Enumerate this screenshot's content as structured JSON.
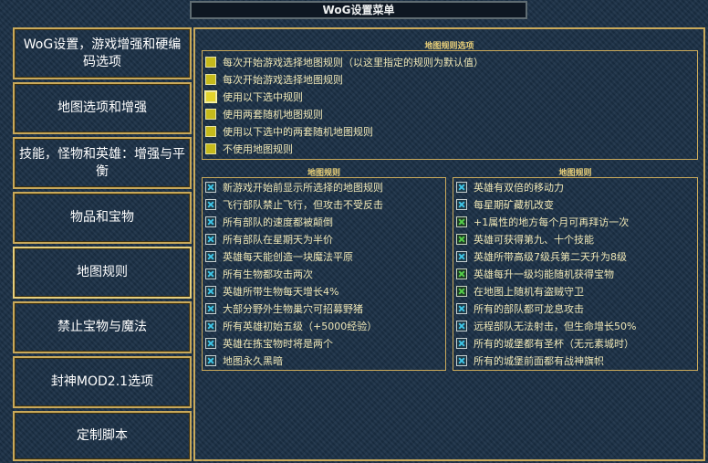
{
  "window": {
    "title": "WoG设置菜单"
  },
  "sidebar": {
    "items": [
      {
        "label": "WoG设置，游戏增强和硬编码选项"
      },
      {
        "label": "地图选项和增强"
      },
      {
        "label": "技能，怪物和英雄：增强与平衡"
      },
      {
        "label": "物品和宝物"
      },
      {
        "label": "地图规则",
        "active": true
      },
      {
        "label": "禁止宝物与魔法"
      },
      {
        "label": "封神MOD2.1选项"
      },
      {
        "label": "定制脚本"
      }
    ]
  },
  "map_rule_options": {
    "title": "地图规则选项",
    "options": [
      {
        "label": "每次开始游戏选择地图规则（以这里指定的规则为默认值）",
        "state": "yellow"
      },
      {
        "label": "每次开始游戏选择地图规则",
        "state": "yellow"
      },
      {
        "label": "使用以下选中规则",
        "state": "selected"
      },
      {
        "label": "使用两套随机地图规则",
        "state": "yellow"
      },
      {
        "label": "使用以下选中的两套随机地图规则",
        "state": "yellow"
      },
      {
        "label": "不使用地图规则",
        "state": "yellow"
      }
    ]
  },
  "rules_left": {
    "title": "地图规则",
    "items": [
      {
        "label": "新游戏开始前显示所选择的地图规则",
        "state": "cyan"
      },
      {
        "label": "飞行部队禁止飞行，但攻击不受反击",
        "state": "cyan"
      },
      {
        "label": "所有部队的速度都被颠倒",
        "state": "cyan"
      },
      {
        "label": "所有部队在星期天为半价",
        "state": "cyan"
      },
      {
        "label": "英雄每天能创造一块魔法平原",
        "state": "cyan"
      },
      {
        "label": "所有生物都攻击两次",
        "state": "cyan"
      },
      {
        "label": "英雄所带生物每天增长4%",
        "state": "cyan"
      },
      {
        "label": "大部分野外生物巢穴可招募野猪",
        "state": "cyan"
      },
      {
        "label": "所有英雄初始五级（+5000经验）",
        "state": "cyan"
      },
      {
        "label": "英雄在拣宝物时将是两个",
        "state": "cyan"
      },
      {
        "label": "地图永久黑暗",
        "state": "cyan"
      }
    ]
  },
  "rules_right": {
    "title": "地图规则",
    "items": [
      {
        "label": "英雄有双倍的移动力",
        "state": "cyan"
      },
      {
        "label": "每星期矿藏机改变",
        "state": "cyan"
      },
      {
        "label": "+1属性的地方每个月可再拜访一次",
        "state": "green"
      },
      {
        "label": "英雄可获得第九、十个技能",
        "state": "green"
      },
      {
        "label": "英雄所带高级7级兵第二天升为8级",
        "state": "cyan"
      },
      {
        "label": "英雄每升一级均能随机获得宝物",
        "state": "green"
      },
      {
        "label": "在地图上随机有盗贼守卫",
        "state": "green"
      },
      {
        "label": "所有的部队都可龙息攻击",
        "state": "cyan"
      },
      {
        "label": "远程部队无法射击，但生命增长50%",
        "state": "cyan"
      },
      {
        "label": "所有的城堡都有圣杯（无元素城时）",
        "state": "cyan"
      },
      {
        "label": "所有的城堡前面都有战神旗帜",
        "state": "cyan"
      }
    ]
  }
}
